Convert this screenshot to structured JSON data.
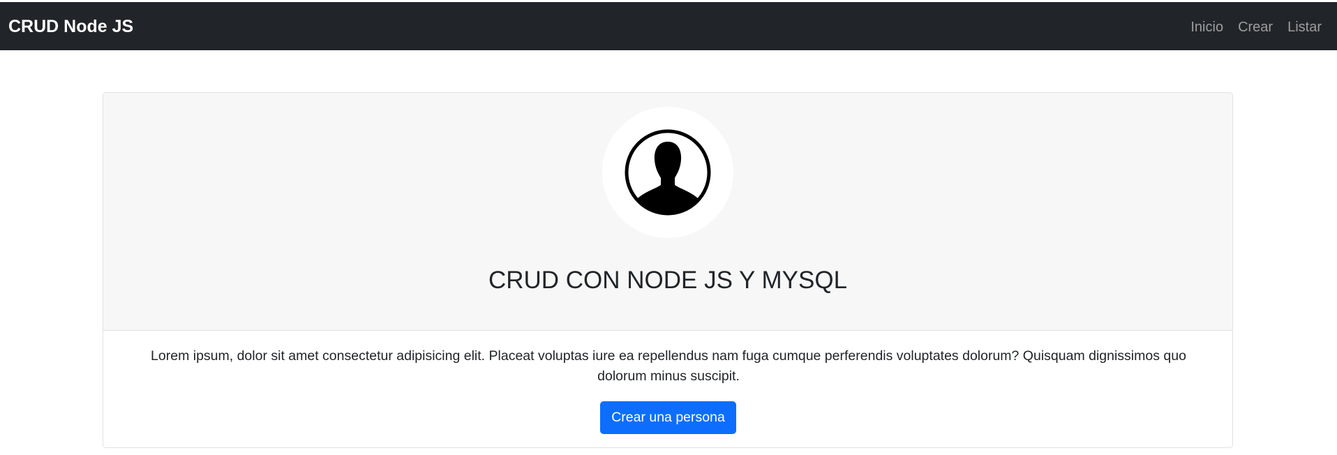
{
  "navbar": {
    "brand": "CRUD Node JS",
    "links": [
      "Inicio",
      "Crear",
      "Listar"
    ],
    "background_color": "#212529"
  },
  "card": {
    "avatar_icon": "user-silhouette-icon",
    "title": "CRUD CON NODE JS Y MYSQL",
    "text": "Lorem ipsum, dolor sit amet consectetur adipisicing elit. Placeat voluptas iure ea repellendus nam fuga cumque perferendis voluptates dolorum? Quisquam dignissimos quo dolorum minus suscipit.",
    "button_label": "Crear una persona",
    "button_color": "#0d6efd"
  }
}
